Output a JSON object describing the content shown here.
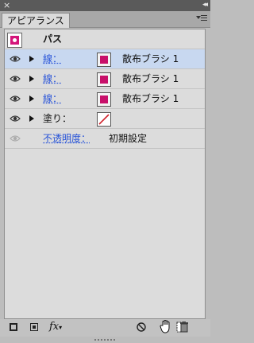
{
  "panel": {
    "close_glyph": "×",
    "collapse_glyph": "◂◂",
    "tab_label": "アピアランス"
  },
  "header": {
    "title": "パス"
  },
  "rows": [
    {
      "label": "線：",
      "value": "散布ブラシ 1",
      "selected": true
    },
    {
      "label": "線：",
      "value": "散布ブラシ 1",
      "selected": false
    },
    {
      "label": "線：",
      "value": "散布ブラシ 1",
      "selected": false
    },
    {
      "label": "塗り："
    },
    {
      "label": "不透明度：",
      "value": "初期設定"
    }
  ],
  "toolbar": {
    "fx_label": "fx"
  },
  "colors": {
    "accent_swatch": "#c8106a",
    "link_blue": "#2a55d8",
    "selection": "#c8d8f0"
  }
}
